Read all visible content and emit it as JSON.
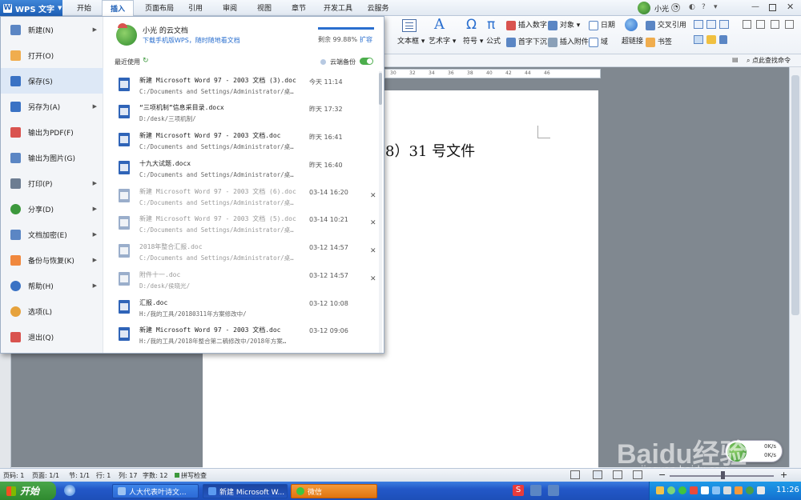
{
  "app": {
    "name": "WPS 文字"
  },
  "tabs": [
    "开始",
    "插入",
    "页面布局",
    "引用",
    "审阅",
    "视图",
    "章节",
    "开发工具",
    "云服务"
  ],
  "active_tab": "插入",
  "user": {
    "name": "小光"
  },
  "ribbon": {
    "text_box": "文本框",
    "art_text": "艺术字",
    "symbol": "符号",
    "formula": "公式",
    "insert_number": "插入数字",
    "object": "对象",
    "drop_cap": "首字下沉",
    "insert_attachment": "插入附件",
    "date": "日期",
    "field": "域",
    "hyperlink": "超链接",
    "cross_ref": "交叉引用",
    "bookmark": "书签",
    "find_command": "点此查找命令"
  },
  "ruler_ticks": [
    "30",
    "32",
    "34",
    "36",
    "38",
    "40",
    "42",
    "44",
    "46"
  ],
  "document": {
    "visible_text": "8）31 号文件"
  },
  "file_menu": {
    "nav": [
      {
        "label": "新建(N)",
        "arrow": true
      },
      {
        "label": "打开(O)",
        "arrow": false
      },
      {
        "label": "保存(S)",
        "arrow": false
      },
      {
        "label": "另存为(A)",
        "arrow": true
      },
      {
        "label": "输出为PDF(F)",
        "arrow": false
      },
      {
        "label": "输出为图片(G)",
        "arrow": false
      },
      {
        "label": "打印(P)",
        "arrow": true
      },
      {
        "label": "分享(D)",
        "arrow": true
      },
      {
        "label": "文档加密(E)",
        "arrow": true
      },
      {
        "label": "备份与恢复(K)",
        "arrow": true
      },
      {
        "label": "帮助(H)",
        "arrow": true
      },
      {
        "label": "选项(L)",
        "arrow": false
      },
      {
        "label": "退出(Q)",
        "arrow": false
      }
    ],
    "selected": "保存(S)",
    "cloud": {
      "title": "小光 的云文档",
      "link": "下载手机版WPS，随时随地看文档",
      "remaining_label": "剩余 99.88%",
      "remaining_fraction": 0.9988,
      "expand": "扩容"
    },
    "recent_label": "最近使用",
    "cloud_backup_label": "云端备份",
    "cloud_backup_on": true,
    "recent": [
      {
        "name": "新建 Microsoft Word 97 - 2003 文档 (3).doc",
        "path": "C:/Documents and Settings/Administrator/桌面/",
        "time": "今天 11:14",
        "dim": false,
        "close": false
      },
      {
        "name": "“三项机制”信息采目录.docx",
        "path": "D:/desk/三项机制/",
        "time": "昨天 17:32",
        "dim": false,
        "close": false
      },
      {
        "name": "新建 Microsoft Word 97 - 2003 文档.doc",
        "path": "C:/Documents and Settings/Administrator/桌面/",
        "time": "昨天 16:41",
        "dim": false,
        "close": false
      },
      {
        "name": "十九大试题.docx",
        "path": "C:/Documents and Settings/Administrator/桌面/",
        "time": "昨天 16:40",
        "dim": false,
        "close": false
      },
      {
        "name": "新建 Microsoft Word 97 - 2003 文档 (6).doc",
        "path": "C:/Documents and Settings/Administrator/桌面/",
        "time": "03-14 16:20",
        "dim": true,
        "close": true
      },
      {
        "name": "新建 Microsoft Word 97 - 2003 文档 (5).doc",
        "path": "C:/Documents and Settings/Administrator/桌面/",
        "time": "03-14 10:21",
        "dim": true,
        "close": true
      },
      {
        "name": "2018年整合汇报.doc",
        "path": "C:/Documents and Settings/Administrator/桌面/",
        "time": "03-12 14:57",
        "dim": true,
        "close": true
      },
      {
        "name": "附件十一.doc",
        "path": "D:/desk/侯晓光/",
        "time": "03-12 14:57",
        "dim": true,
        "close": true
      },
      {
        "name": "汇报.doc",
        "path": "H:/我的工具/20180311年方案修改中/",
        "time": "03-12 10:08",
        "dim": false,
        "close": false
      },
      {
        "name": "新建 Microsoft Word 97 - 2003 文档.doc",
        "path": "H:/我的工具/2018年整合第二稿修改中/2018年方案…",
        "time": "03-12 09:06",
        "dim": false,
        "close": false
      }
    ]
  },
  "status_bar": {
    "page": "页码: 1",
    "pages": "页面: 1/1",
    "section": "节: 1/1",
    "row": "行: 1",
    "col": "列: 17",
    "words": "字数: 12",
    "spell": "拼写检查",
    "zoom_minus": "−",
    "zoom_plus": "+"
  },
  "net_speed": {
    "up": "0K/s",
    "down": "0K/s"
  },
  "taskbar": {
    "start": "开始",
    "tasks": [
      "人大代表叶诗文...",
      "新建 Microsoft W...",
      "微信"
    ],
    "active_task": "新建 Microsoft W...",
    "clock": "11:26"
  },
  "watermark": {
    "text": "Baidu经验",
    "url": "jingyan.baidu.com"
  },
  "colors": {
    "accent": "#1e5fb6",
    "link": "#2a6fcf",
    "toggle": "#4cae4c",
    "taskbar": "#2358c8",
    "start": "#3c983c",
    "wechat_task": "#f07c1c"
  }
}
